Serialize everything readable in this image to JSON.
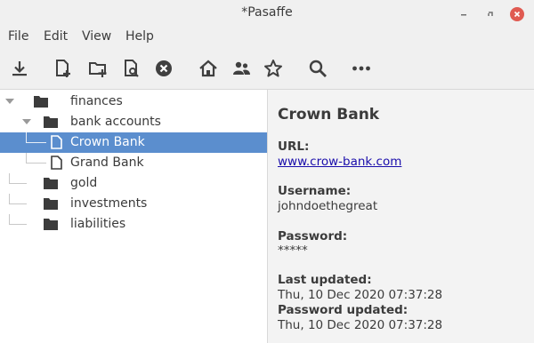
{
  "window": {
    "title": "*Pasaffe"
  },
  "menubar": {
    "items": [
      "File",
      "Edit",
      "View",
      "Help"
    ]
  },
  "toolbar": {
    "icons": [
      "download-icon",
      "new-entry-icon",
      "new-folder-icon",
      "edit-entry-icon",
      "delete-icon",
      "home-icon",
      "users-icon",
      "star-icon",
      "search-icon",
      "more-icon"
    ]
  },
  "tree": {
    "items": [
      {
        "label": "finances",
        "type": "folder",
        "level": 0,
        "expanded": true,
        "selected": false
      },
      {
        "label": "bank accounts",
        "type": "folder",
        "level": 1,
        "expanded": true,
        "selected": false
      },
      {
        "label": "Crown Bank",
        "type": "entry",
        "level": 2,
        "selected": true
      },
      {
        "label": "Grand Bank",
        "type": "entry",
        "level": 2,
        "selected": false
      },
      {
        "label": "gold",
        "type": "folder",
        "level": 1,
        "selected": false
      },
      {
        "label": "investments",
        "type": "folder",
        "level": 1,
        "selected": false
      },
      {
        "label": "liabilities",
        "type": "folder",
        "level": 1,
        "selected": false
      }
    ]
  },
  "details": {
    "title": "Crown Bank",
    "url_label": "URL:",
    "url_value": "www.crow-bank.com",
    "username_label": "Username:",
    "username_value": "johndoethegreat",
    "password_label": "Password:",
    "password_value": "*****",
    "last_updated_label": "Last updated:",
    "last_updated_value": "Thu, 10 Dec 2020 07:37:28",
    "password_updated_label": "Password updated:",
    "password_updated_value": "Thu, 10 Dec 2020 07:37:28"
  },
  "colors": {
    "selection": "#5b8ece",
    "close_button": "#e05a51",
    "link": "#1a0dab"
  }
}
